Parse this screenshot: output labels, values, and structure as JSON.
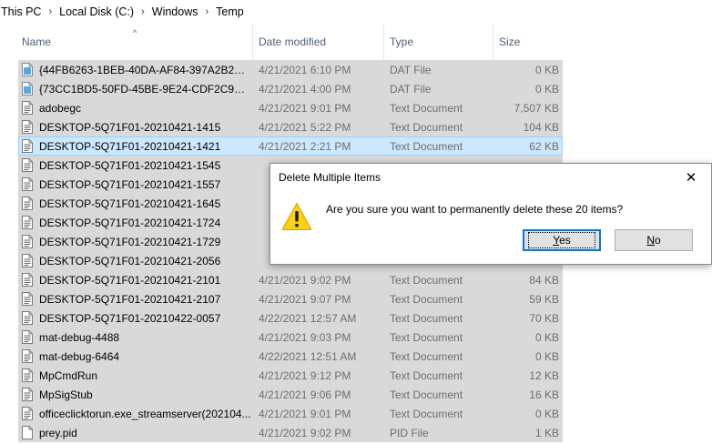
{
  "breadcrumb": [
    "This PC",
    "Local Disk (C:)",
    "Windows",
    "Temp"
  ],
  "columns": {
    "name": "Name",
    "date": "Date modified",
    "type": "Type",
    "size": "Size"
  },
  "sort_indicator": "^",
  "files": [
    {
      "name": "{44FB6263-1BEB-40DA-AF84-397A2B2E9...",
      "date": "4/21/2021 6:10 PM",
      "type": "DAT File",
      "size": "0 KB",
      "icon": "dat-file-icon"
    },
    {
      "name": "{73CC1BD5-50FD-45BE-9E24-CDF2C9F45...",
      "date": "4/21/2021 4:00 PM",
      "type": "DAT File",
      "size": "0 KB",
      "icon": "dat-file-icon"
    },
    {
      "name": "adobegc",
      "date": "4/21/2021 9:01 PM",
      "type": "Text Document",
      "size": "7,507 KB",
      "icon": "text-document-icon"
    },
    {
      "name": "DESKTOP-5Q71F01-20210421-1415",
      "date": "4/21/2021 5:22 PM",
      "type": "Text Document",
      "size": "104 KB",
      "icon": "text-document-icon"
    },
    {
      "name": "DESKTOP-5Q71F01-20210421-1421",
      "date": "4/21/2021 2:21 PM",
      "type": "Text Document",
      "size": "62 KB",
      "icon": "text-document-icon",
      "focused": true
    },
    {
      "name": "DESKTOP-5Q71F01-20210421-1545",
      "date": "",
      "type": "",
      "size": "",
      "icon": "text-document-icon"
    },
    {
      "name": "DESKTOP-5Q71F01-20210421-1557",
      "date": "",
      "type": "",
      "size": "",
      "icon": "text-document-icon"
    },
    {
      "name": "DESKTOP-5Q71F01-20210421-1645",
      "date": "",
      "type": "",
      "size": "",
      "icon": "text-document-icon"
    },
    {
      "name": "DESKTOP-5Q71F01-20210421-1724",
      "date": "",
      "type": "",
      "size": "",
      "icon": "text-document-icon"
    },
    {
      "name": "DESKTOP-5Q71F01-20210421-1729",
      "date": "",
      "type": "",
      "size": "",
      "icon": "text-document-icon"
    },
    {
      "name": "DESKTOP-5Q71F01-20210421-2056",
      "date": "",
      "type": "",
      "size": "",
      "icon": "text-document-icon"
    },
    {
      "name": "DESKTOP-5Q71F01-20210421-2101",
      "date": "4/21/2021 9:02 PM",
      "type": "Text Document",
      "size": "84 KB",
      "icon": "text-document-icon"
    },
    {
      "name": "DESKTOP-5Q71F01-20210421-2107",
      "date": "4/21/2021 9:07 PM",
      "type": "Text Document",
      "size": "59 KB",
      "icon": "text-document-icon"
    },
    {
      "name": "DESKTOP-5Q71F01-20210422-0057",
      "date": "4/22/2021 12:57 AM",
      "type": "Text Document",
      "size": "70 KB",
      "icon": "text-document-icon"
    },
    {
      "name": "mat-debug-4488",
      "date": "4/21/2021 9:03 PM",
      "type": "Text Document",
      "size": "0 KB",
      "icon": "text-document-icon"
    },
    {
      "name": "mat-debug-6464",
      "date": "4/22/2021 12:51 AM",
      "type": "Text Document",
      "size": "0 KB",
      "icon": "text-document-icon"
    },
    {
      "name": "MpCmdRun",
      "date": "4/21/2021 9:12 PM",
      "type": "Text Document",
      "size": "12 KB",
      "icon": "text-document-icon"
    },
    {
      "name": "MpSigStub",
      "date": "4/21/2021 9:06 PM",
      "type": "Text Document",
      "size": "16 KB",
      "icon": "text-document-icon"
    },
    {
      "name": "officeclicktorun.exe_streamserver(202104...",
      "date": "4/21/2021 9:01 PM",
      "type": "Text Document",
      "size": "0 KB",
      "icon": "text-document-icon"
    },
    {
      "name": "prey.pid",
      "date": "4/21/2021 9:02 PM",
      "type": "PID File",
      "size": "1 KB",
      "icon": "blank-file-icon"
    }
  ],
  "dialog": {
    "title": "Delete Multiple Items",
    "close_glyph": "✕",
    "message": "Are you sure you want to permanently delete these 20 items?",
    "icon": "warning-icon",
    "yes_label": "Yes",
    "no_label": "No"
  },
  "colors": {
    "selection": "#d9d9d9",
    "focused_row": "#cce8ff",
    "accent": "#0078d7",
    "warning": "#fcd116"
  }
}
